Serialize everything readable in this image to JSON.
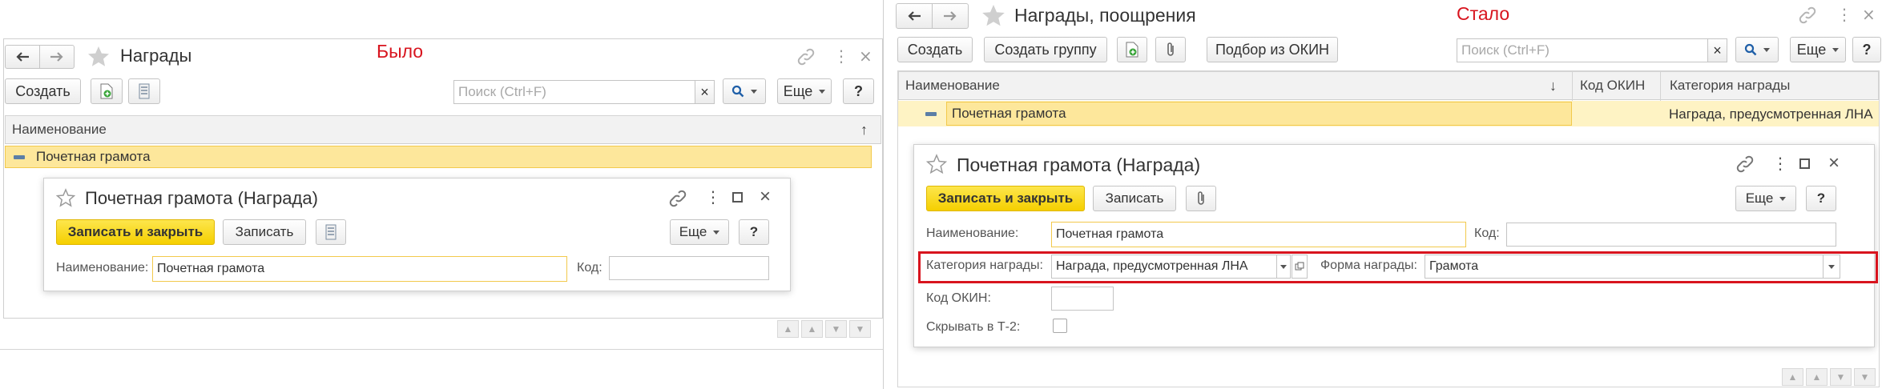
{
  "captions": {
    "before": "Было",
    "after": "Стало"
  },
  "left": {
    "window_title": "Награды",
    "toolbar": {
      "create": "Создать",
      "search_placeholder": "Поиск (Ctrl+F)",
      "more": "Еще",
      "help": "?"
    },
    "list": {
      "column_name": "Наименование",
      "sort_indicator": "↑",
      "rows": [
        "Почетная грамота"
      ]
    },
    "form": {
      "title": "Почетная грамота (Награда)",
      "save_close": "Записать и закрыть",
      "save": "Записать",
      "more": "Еще",
      "help": "?",
      "name_label": "Наименование:",
      "name_value": "Почетная грамота",
      "code_label": "Код:",
      "code_value": ""
    }
  },
  "right": {
    "window_title": "Награды, поощрения",
    "toolbar": {
      "create": "Создать",
      "create_group": "Создать группу",
      "okin": "Подбор из ОКИН",
      "search_placeholder": "Поиск (Ctrl+F)",
      "more": "Еще",
      "help": "?"
    },
    "list": {
      "columns": [
        "Наименование",
        "Код ОКИН",
        "Категория награды"
      ],
      "sort_indicator": "↓",
      "rows": [
        {
          "name": "Почетная грамота",
          "okin": "",
          "category": "Награда, предусмотренная ЛНА"
        }
      ]
    },
    "form": {
      "title": "Почетная грамота (Награда)",
      "save_close": "Записать и закрыть",
      "save": "Записать",
      "more": "Еще",
      "help": "?",
      "name_label": "Наименование:",
      "name_value": "Почетная грамота",
      "code_label": "Код:",
      "code_value": "",
      "category_label": "Категория награды:",
      "category_value": "Награда, предусмотренная ЛНА",
      "form_label": "Форма награды:",
      "form_value": "Грамота",
      "okin_label": "Код ОКИН:",
      "okin_value": "",
      "hide_label": "Скрывать в Т-2:",
      "hide_checked": false
    }
  },
  "colors": {
    "accent_yellow": "#f5cf00",
    "highlight_red": "#d8141e",
    "caption_red": "#d8141e"
  }
}
